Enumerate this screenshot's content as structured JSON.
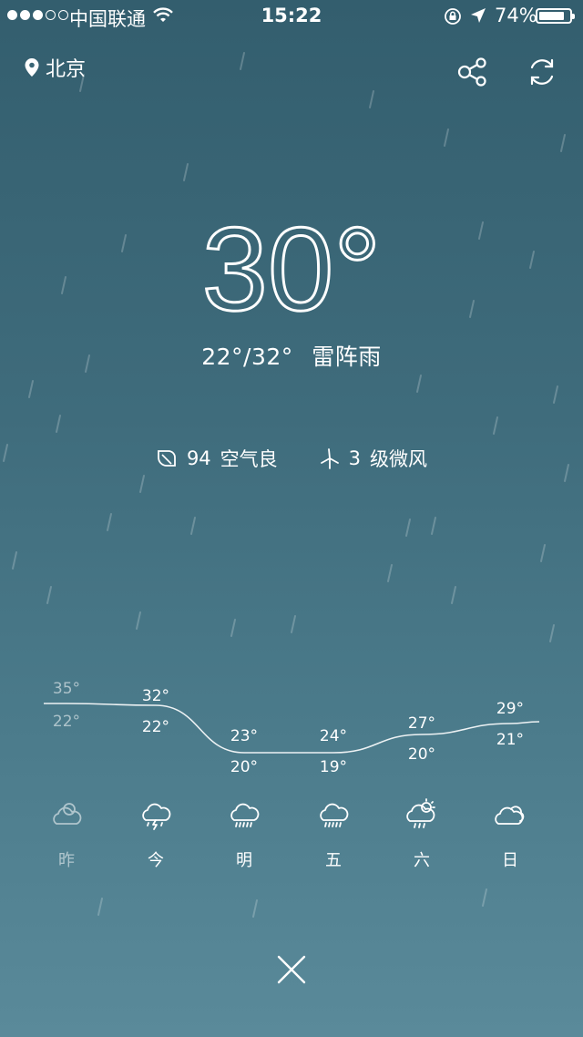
{
  "status_bar": {
    "carrier": "中国联通",
    "time": "15:22",
    "battery_text": "74%",
    "battery_level": 0.74
  },
  "header": {
    "city": "北京",
    "icons": [
      "location-pin-icon",
      "share-icon",
      "refresh-icon"
    ]
  },
  "current": {
    "temperature": "30°",
    "range": "22°/32°",
    "condition": "雷阵雨",
    "aqi_value": "94",
    "aqi_text": "空气良",
    "wind_level": "3",
    "wind_text": "级微风"
  },
  "forecast": [
    {
      "day": "昨",
      "high": "35°",
      "low": "22°",
      "icon": "partly-cloudy-icon",
      "dim": true
    },
    {
      "day": "今",
      "high": "32°",
      "low": "22°",
      "icon": "thunderstorm-icon",
      "dim": false
    },
    {
      "day": "明",
      "high": "23°",
      "low": "20°",
      "icon": "rain-icon",
      "dim": false
    },
    {
      "day": "五",
      "high": "24°",
      "low": "19°",
      "icon": "rain-icon",
      "dim": false
    },
    {
      "day": "六",
      "high": "27°",
      "low": "20°",
      "icon": "sun-rain-icon",
      "dim": false
    },
    {
      "day": "日",
      "high": "29°",
      "low": "21°",
      "icon": "cloudy-icon",
      "dim": false
    }
  ],
  "close_icon": "close-icon",
  "colors": {
    "bg_top": "#335e6e",
    "bg_bottom": "#5a8a9a",
    "text": "#ffffff"
  }
}
